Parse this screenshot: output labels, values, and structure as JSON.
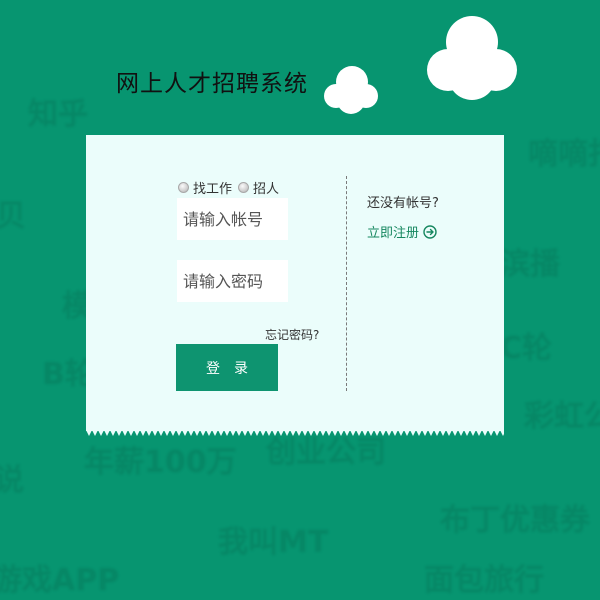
{
  "app": {
    "title": "网上人才招聘系统"
  },
  "background_words": [
    {
      "text": "知乎",
      "cls": "w1"
    },
    {
      "text": "嘀嘀打",
      "cls": "w2"
    },
    {
      "text": "贝",
      "cls": "w3"
    },
    {
      "text": "滨播",
      "cls": "w4"
    },
    {
      "text": "模",
      "cls": "w5"
    },
    {
      "text": "B轮",
      "cls": "w6"
    },
    {
      "text": "C轮",
      "cls": "w7"
    },
    {
      "text": "彩虹公",
      "cls": "w8"
    },
    {
      "text": "年薪100万",
      "cls": "w9"
    },
    {
      "text": "创业公司",
      "cls": "w10"
    },
    {
      "text": "说",
      "cls": "w11"
    },
    {
      "text": "布丁优惠券",
      "cls": "w12"
    },
    {
      "text": "我叫MT",
      "cls": "w13"
    },
    {
      "text": "游戏APP",
      "cls": "w14"
    },
    {
      "text": "面包旅行",
      "cls": "w15"
    }
  ],
  "login": {
    "role_options": [
      "找工作",
      "招人"
    ],
    "account_placeholder": "请输入帐号",
    "password_placeholder": "请输入密码",
    "forgot_label": "忘记密码?",
    "login_label": "登录"
  },
  "register": {
    "prompt": "还没有帐号?",
    "link_label": "立即注册"
  },
  "colors": {
    "background": "#079570",
    "card": "#ebfdfb",
    "button": "#0e9470",
    "link": "#16875f"
  },
  "icons": [
    "cloud-icon",
    "radio-icon",
    "arrow-right-circle-icon"
  ]
}
